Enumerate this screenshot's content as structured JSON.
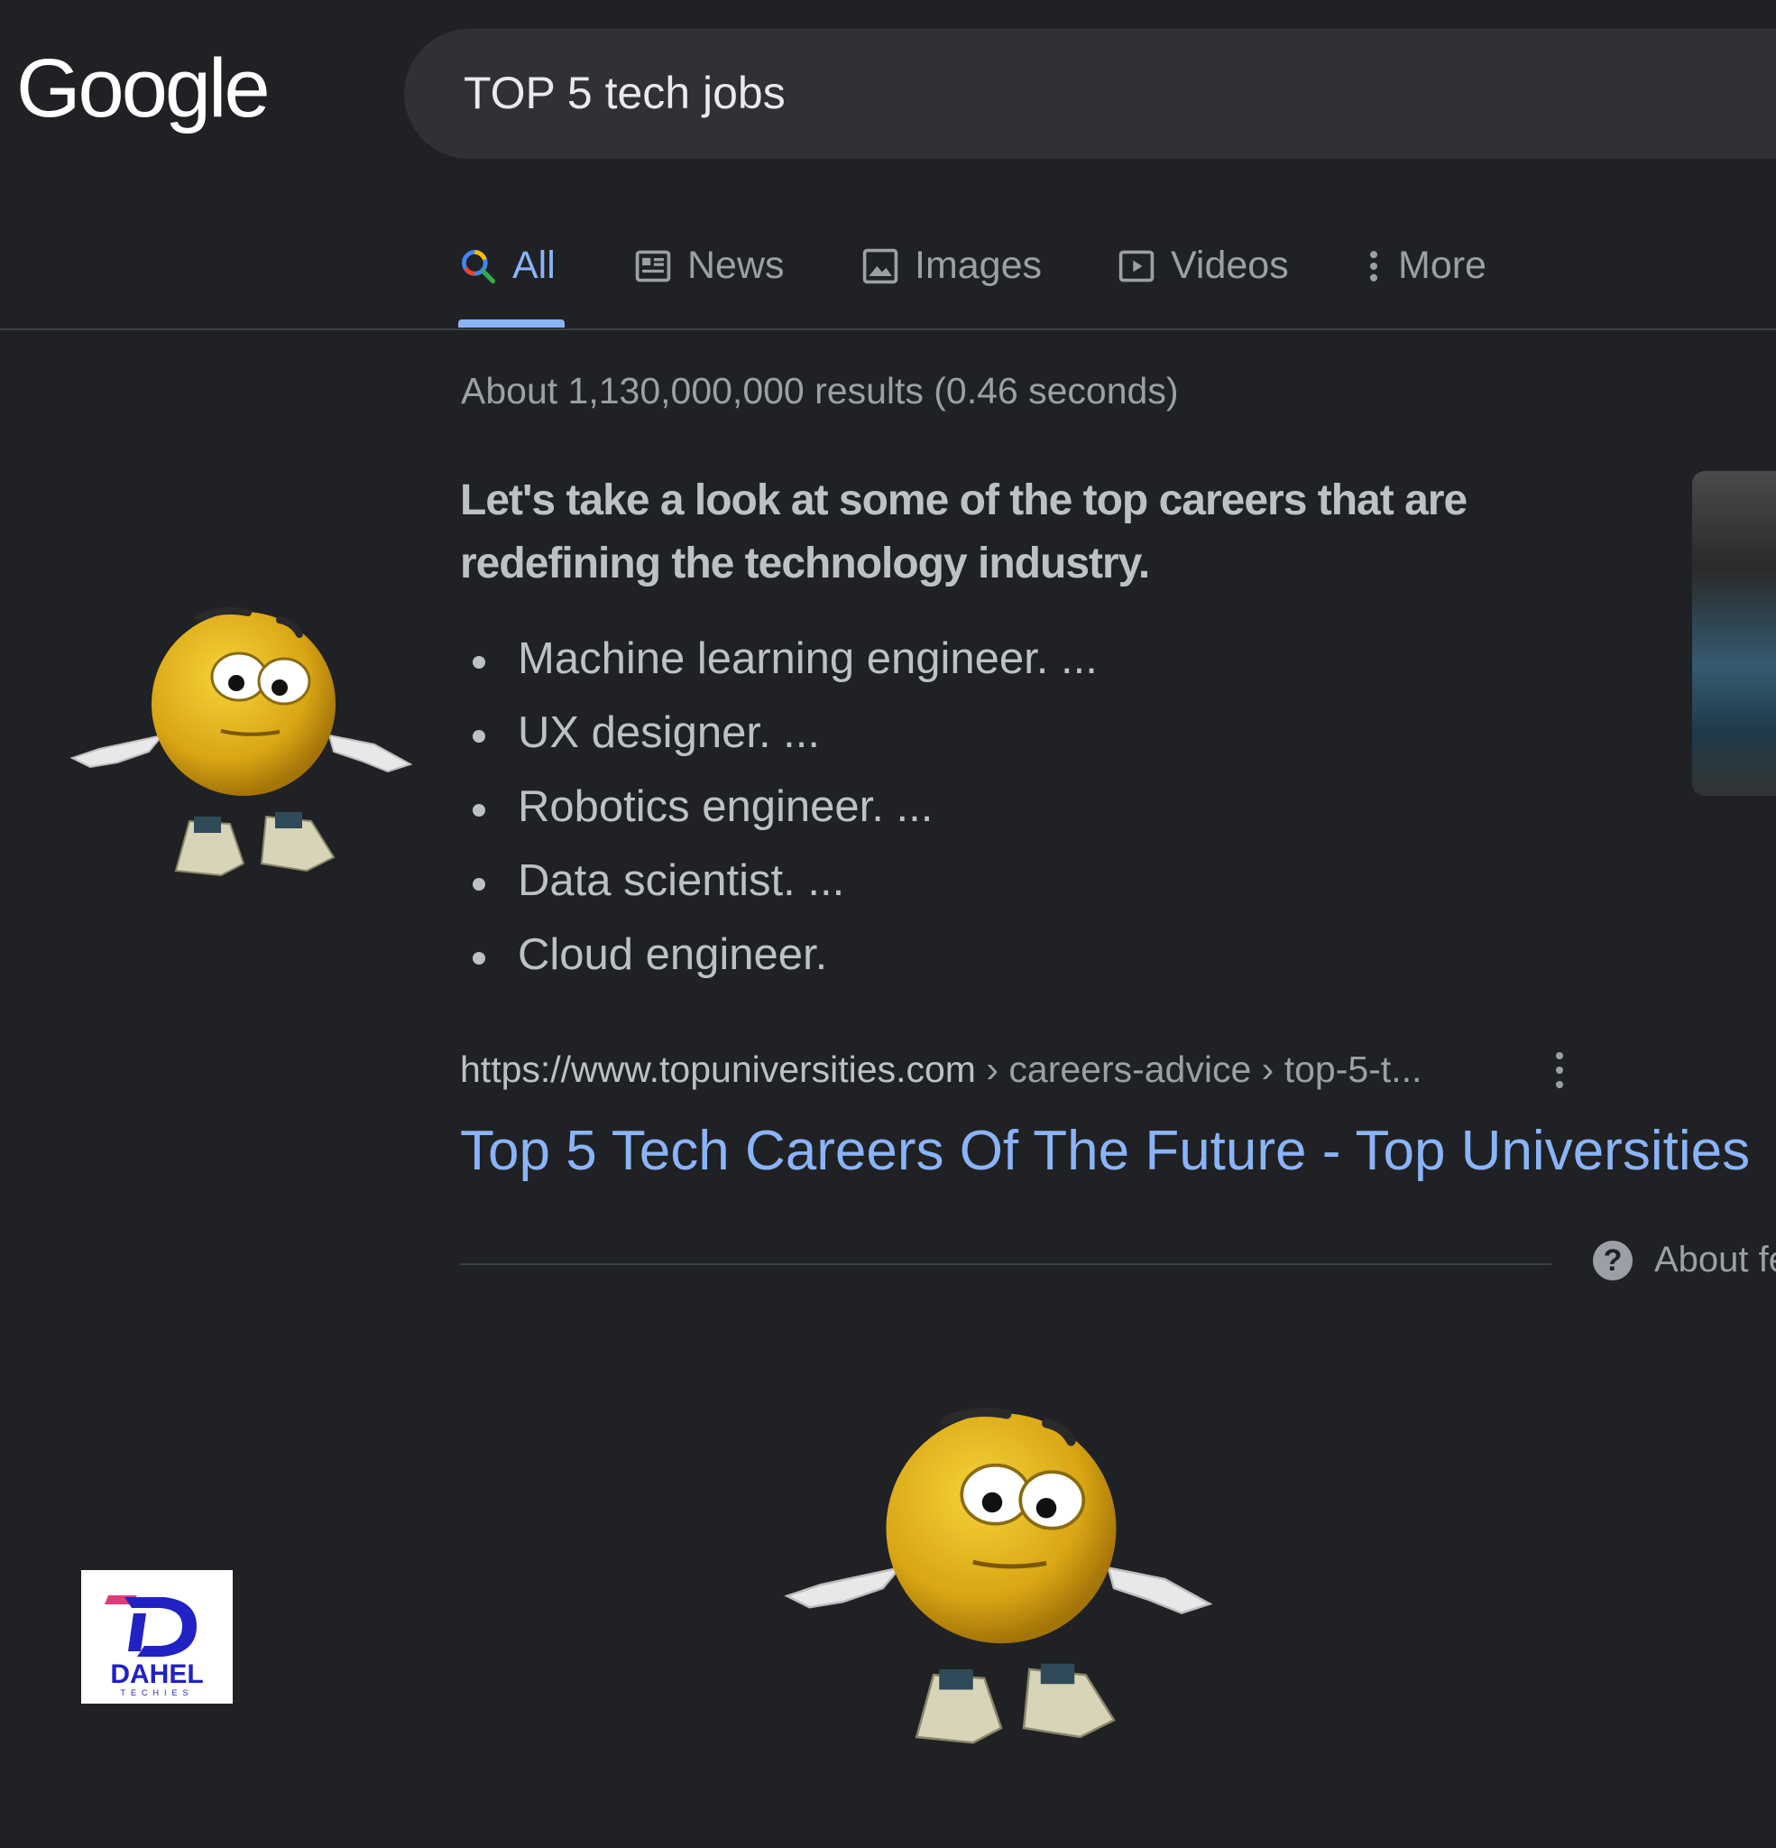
{
  "logo": {
    "text": "Google"
  },
  "search": {
    "query": "TOP 5 tech jobs"
  },
  "tabs": [
    {
      "label": "All",
      "icon": "search-icon",
      "active": true
    },
    {
      "label": "News",
      "icon": "news-icon"
    },
    {
      "label": "Images",
      "icon": "image-icon"
    },
    {
      "label": "Videos",
      "icon": "play-icon"
    },
    {
      "label": "More",
      "icon": "more-vertical-icon"
    }
  ],
  "result_stats": "About 1,130,000,000 results (0.46 seconds)",
  "featured_snippet": {
    "headline": "Let's take a look at some of the top careers that are redefining the technology industry.",
    "items": [
      "Machine learning engineer. ...",
      "UX designer. ...",
      "Robotics engineer. ...",
      "Data scientist. ...",
      "Cloud engineer."
    ],
    "cite": {
      "domain": "https://www.topuniversities.com",
      "path": " › careers-advice › top-5-t..."
    },
    "title": "Top 5 Tech Careers Of The Future - Top Universities",
    "about_label": "About fe"
  },
  "brand_badge": {
    "name": "DAHEL",
    "tagline": "TECHIES"
  },
  "colors": {
    "background": "#202124",
    "link": "#8ab4f8",
    "text": "#bdc1c6",
    "muted": "#9aa0a6"
  }
}
